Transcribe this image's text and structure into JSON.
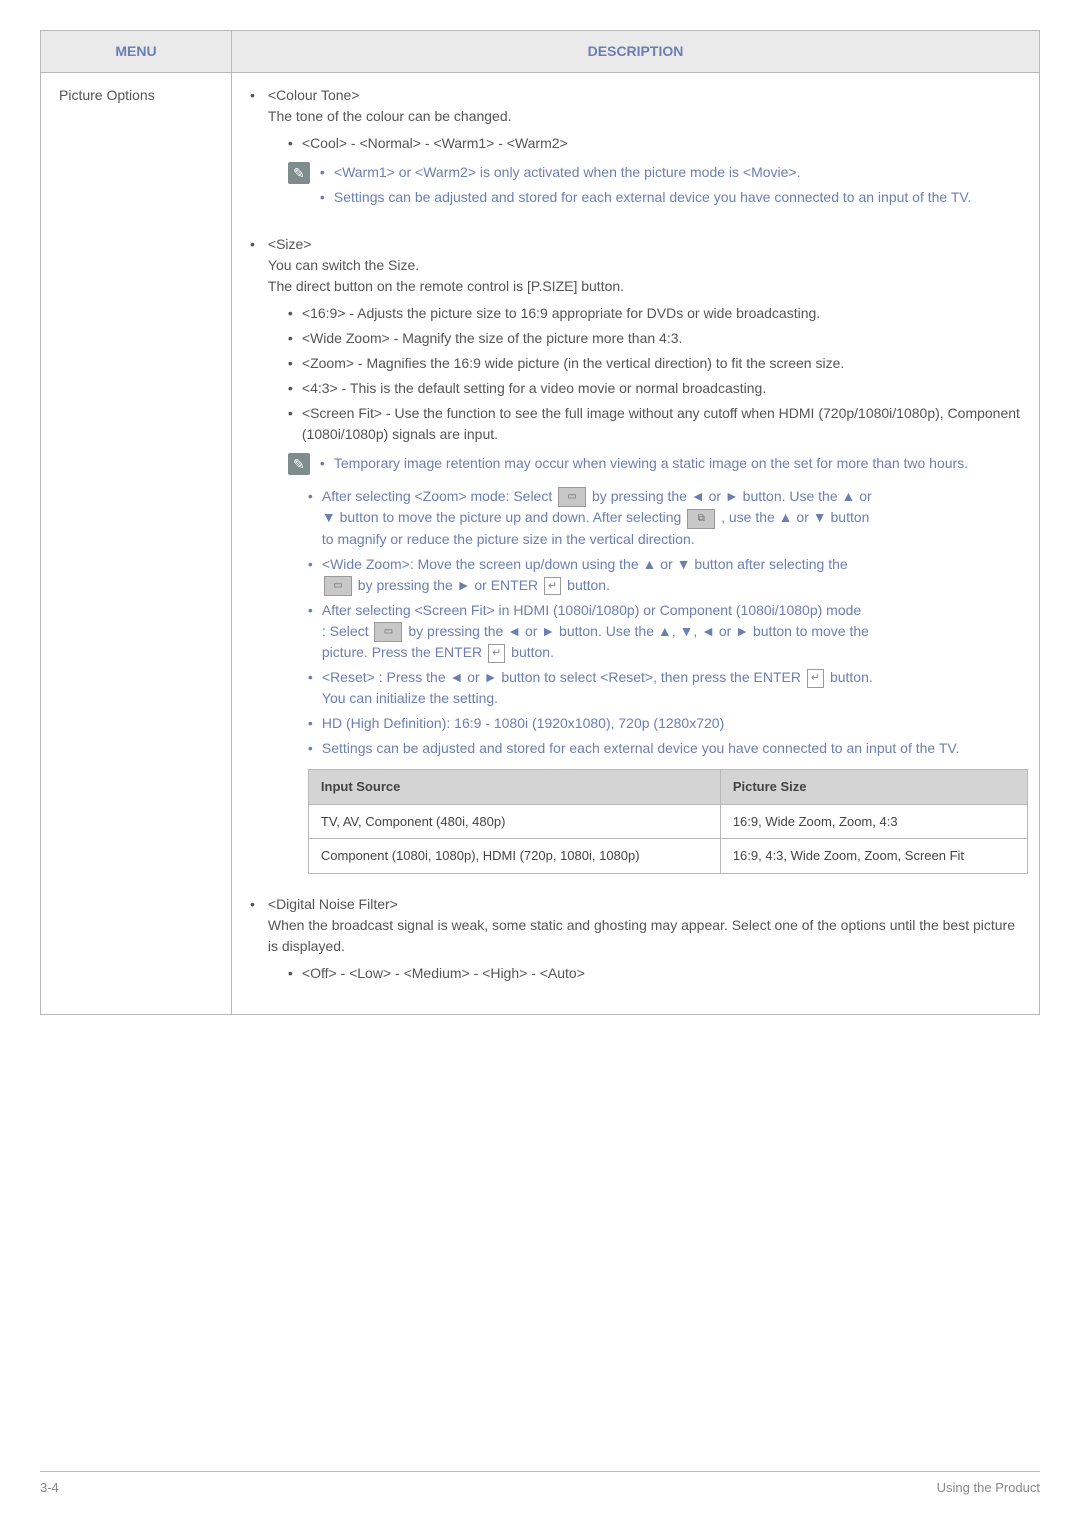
{
  "header": {
    "menu": "MENU",
    "description": "DESCRIPTION"
  },
  "menu_label": "Picture Options",
  "colour_tone": {
    "title": "<Colour Tone>",
    "desc": "The tone of the colour can be changed.",
    "options": "<Cool> - <Normal> - <Warm1> - <Warm2>",
    "notes": [
      "<Warm1> or <Warm2> is only activated when the picture mode is <Movie>.",
      "Settings can be adjusted and stored for each external device you have connected to an input of the TV."
    ]
  },
  "size": {
    "title": "<Size>",
    "desc1": "You can switch the Size.",
    "desc2": "The direct button on the remote control is [P.SIZE] button.",
    "items": [
      "<16:9> - Adjusts the picture size to 16:9 appropriate for DVDs or wide broadcasting.",
      "<Wide Zoom> - Magnify the size of the picture more than 4:3.",
      "<Zoom> - Magnifies the 16:9 wide picture (in the vertical direction) to fit the screen size.",
      "<4:3> - This is the default setting for a video movie or normal broadcasting.",
      "<Screen Fit> - Use the function to see the full image without any cutoff when HDMI (720p/1080i/1080p), Component (1080i/1080p) signals are input."
    ],
    "notes_a": [
      "Temporary image retention may occur when viewing a static image on the set for more than two hours."
    ],
    "notes_b_prefix": "After selecting <Zoom> mode: Select",
    "notes_b_mid": "by pressing the ◄ or ► button. Use the ▲ or",
    "notes_b_line2a": "▼ button to move the picture up and down. After selecting",
    "notes_b_line2b": ", use the ▲ or ▼ button",
    "notes_b_line3": "to magnify or reduce the picture size in the vertical direction.",
    "notes_c_line1": "<Wide Zoom>: Move the screen up/down using the ▲ or ▼ button after selecting the",
    "notes_c_line2_prefix": "",
    "notes_c_line2": "by pressing the ► or ENTER",
    "notes_c_line2_suffix": "button.",
    "notes_d_line1": "After selecting <Screen Fit> in HDMI (1080i/1080p) or Component (1080i/1080p) mode",
    "notes_d_line2_prefix": ": Select",
    "notes_d_line2": "by pressing the ◄ or ► button. Use the ▲, ▼, ◄ or ► button to move the",
    "notes_d_line3_prefix": "picture. Press the ENTER",
    "notes_d_line3_suffix": "button.",
    "notes_e_line1_prefix": "<Reset> : Press the ◄ or ► button to select <Reset>, then press the ENTER",
    "notes_e_line1_suffix": "button.",
    "notes_e_line2": "You can initialize the setting.",
    "notes_f": "HD (High Definition): 16:9 - 1080i (1920x1080), 720p (1280x720)",
    "notes_g": "Settings can be adjusted and stored for each external device you have connected to an input of the TV.",
    "table": {
      "h1": "Input  Source",
      "h2": "Picture Size",
      "r1c1": "TV, AV, Component (480i, 480p)",
      "r1c2": "16:9, Wide Zoom, Zoom, 4:3",
      "r2c1": "Component (1080i, 1080p), HDMI (720p, 1080i, 1080p)",
      "r2c2": "16:9, 4:3, Wide Zoom, Zoom, Screen Fit"
    }
  },
  "dnf": {
    "title": "<Digital Noise Filter>",
    "desc": "When the broadcast signal is weak, some static and ghosting may appear. Select one of the options until the best picture is displayed.",
    "options": "<Off> - <Low> - <Medium> - <High> - <Auto>"
  },
  "footer": {
    "left": "3-4",
    "right": "Using the Product"
  },
  "chart_data": {
    "type": "table",
    "title": "Picture Options — Input Source vs Picture Size",
    "columns": [
      "Input Source",
      "Picture Size"
    ],
    "rows": [
      [
        "TV, AV, Component (480i, 480p)",
        "16:9, Wide Zoom, Zoom, 4:3"
      ],
      [
        "Component (1080i, 1080p), HDMI (720p, 1080i, 1080p)",
        "16:9, 4:3, Wide Zoom, Zoom, Screen Fit"
      ]
    ]
  }
}
